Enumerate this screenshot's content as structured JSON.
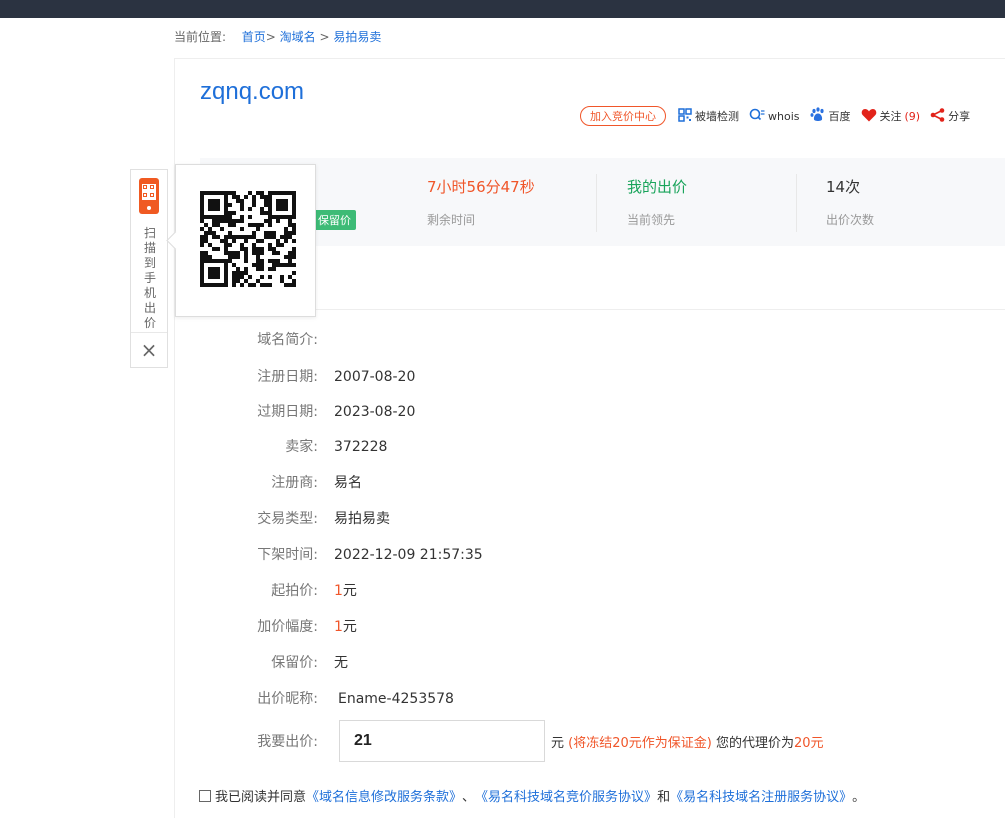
{
  "breadcrumb": {
    "prefix": "当前位置:",
    "home": "首页",
    "sep1": ">",
    "section": "淘域名",
    "sep2": ">",
    "current": "易拍易卖"
  },
  "domain": {
    "name": "zqnq.com"
  },
  "actions": {
    "join_label": "加入竞价中心",
    "block_check_label": "被墙检测",
    "whois_label": "whois",
    "baidu_label": "百度",
    "follow_label": "关注",
    "follow_count": "(9)",
    "share_label": "分享",
    "icons": [
      "qr-check-icon",
      "search-icon",
      "baidu-paw-icon",
      "heart-icon",
      "share-icon"
    ]
  },
  "stats": {
    "reserve_tag": "保留价",
    "time_left_value": "7小时56分47秒",
    "time_left_label": "剩余时间",
    "my_bid_value": "我的出价",
    "my_bid_label": "当前领先",
    "bid_count_value": "14次",
    "bid_count_label": "出价次数",
    "colors": {
      "time": "#f0562a",
      "leading": "#19a45b"
    }
  },
  "details": [
    {
      "label": "域名简介:",
      "value": ""
    },
    {
      "label": "注册日期:",
      "value": "2007-08-20"
    },
    {
      "label": "过期日期:",
      "value": "2023-08-20"
    },
    {
      "label": "卖家:",
      "value": "372228"
    },
    {
      "label": "注册商:",
      "value": "易名"
    },
    {
      "label": "交易类型:",
      "value": "易拍易卖"
    },
    {
      "label": "下架时间:",
      "value": "2022-12-09 21:57:35"
    },
    {
      "label": "起拍价:",
      "value_num": "1",
      "value_unit": "元"
    },
    {
      "label": "加价幅度:",
      "value_num": "1",
      "value_unit": "元"
    },
    {
      "label": "保留价:",
      "value": "无"
    },
    {
      "label": "出价昵称:",
      "value": "Ename-4253578"
    }
  ],
  "bid": {
    "label": "我要出价:",
    "input_value": "21",
    "unit": "元",
    "freeze_note": "(将冻结20元作为保证金)",
    "proxy_text": "您的代理价为",
    "proxy_value": "20元"
  },
  "agreement": {
    "prefix": "我已阅读并同意",
    "link1": "《域名信息修改服务条款》",
    "sep": "、",
    "link2": "《易名科技域名竞价服务协议》",
    "and": "和",
    "link3": "《易名科技域名注册服务协议》",
    "end": "。"
  },
  "side_float": {
    "text": "扫描到手机出价",
    "close": "×",
    "icon": "phone-qr-icon"
  },
  "qr_popup": {
    "icon": "qr-code-image"
  },
  "colors": {
    "accent": "#1e6fd9",
    "orange": "#f0562a",
    "green": "#3dbb76",
    "topbar": "#2b3341"
  }
}
